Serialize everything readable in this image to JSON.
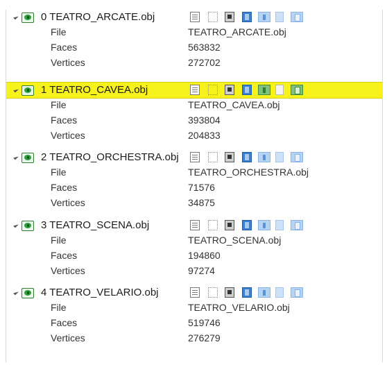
{
  "layers": [
    {
      "name": "0 TEATRO_ARCATE.obj",
      "selected": false,
      "props": [
        {
          "key": "File",
          "value": "TEATRO_ARCATE.obj"
        },
        {
          "key": "Faces",
          "value": "563832"
        },
        {
          "key": "Vertices",
          "value": "272702"
        }
      ]
    },
    {
      "name": "1 TEATRO_CAVEA.obj",
      "selected": true,
      "props": [
        {
          "key": "File",
          "value": "TEATRO_CAVEA.obj"
        },
        {
          "key": "Faces",
          "value": "393804"
        },
        {
          "key": "Vertices",
          "value": "204833"
        }
      ]
    },
    {
      "name": "2 TEATRO_ORCHESTRA.obj",
      "selected": false,
      "props": [
        {
          "key": "File",
          "value": "TEATRO_ORCHESTRA.obj"
        },
        {
          "key": "Faces",
          "value": "71576"
        },
        {
          "key": "Vertices",
          "value": "34875"
        }
      ]
    },
    {
      "name": "3 TEATRO_SCENA.obj",
      "selected": false,
      "props": [
        {
          "key": "File",
          "value": "TEATRO_SCENA.obj"
        },
        {
          "key": "Faces",
          "value": "194860"
        },
        {
          "key": "Vertices",
          "value": "97274"
        }
      ]
    },
    {
      "name": "4 TEATRO_VELARIO.obj",
      "selected": false,
      "props": [
        {
          "key": "File",
          "value": "TEATRO_VELARIO.obj"
        },
        {
          "key": "Faces",
          "value": "519746"
        },
        {
          "key": "Vertices",
          "value": "276279"
        }
      ]
    }
  ],
  "icons": {
    "visibility": "eye-icon",
    "tools": [
      "document-icon",
      "selection-icon",
      "box-icon",
      "bookmark-icon",
      "layer-icon",
      "layer-icon",
      "layer-icon"
    ]
  },
  "colors": {
    "selection": "#f7f21c",
    "visibility": "#2e9e3f",
    "tool_blue": "#3a7fd1"
  }
}
